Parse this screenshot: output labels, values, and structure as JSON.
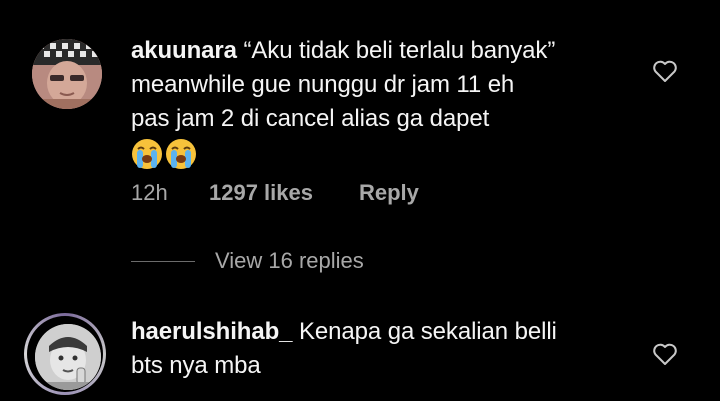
{
  "comments": [
    {
      "username": "akuunara",
      "text_lines": [
        "“Aku tidak beli terlalu banyak”",
        "meanwhile gue nunggu dr jam 11 eh",
        "pas jam 2 di cancel alias ga dapet"
      ],
      "emojis": [
        "loudly-crying-face",
        "loudly-crying-face"
      ],
      "time": "12h",
      "likes": "1297 likes",
      "reply_label": "Reply",
      "view_replies": "View 16 replies",
      "like_icon": "heart-outline-icon"
    },
    {
      "username": "haerulshihab_",
      "text_lines": [
        "Kenapa ga sekalian belli",
        "bts nya mba"
      ],
      "like_icon": "heart-outline-icon"
    }
  ],
  "colors": {
    "background": "#000000",
    "text": "#f5f5f5",
    "meta": "#a8a8a8"
  }
}
